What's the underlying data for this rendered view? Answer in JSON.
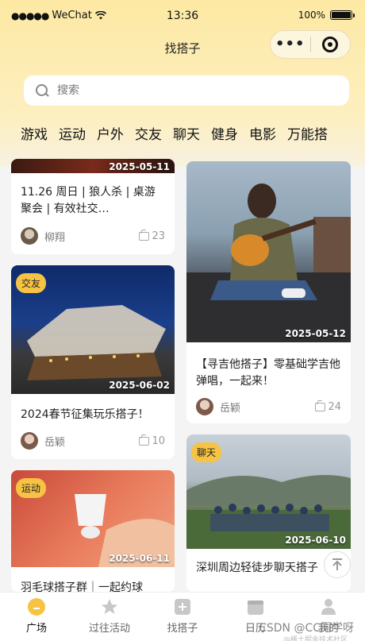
{
  "status_bar": {
    "carrier": "WeChat",
    "signal_dots": "●●●●●",
    "time": "13:36",
    "battery_text": "100%",
    "battery_level": 1.0
  },
  "nav": {
    "title": "找搭子",
    "more_glyph": "•••"
  },
  "search": {
    "placeholder": "搜索"
  },
  "categories": [
    "游戏",
    "运动",
    "户外",
    "交友",
    "聊天",
    "健身",
    "电影",
    "万能搭"
  ],
  "cards": [
    {
      "title": "11.26 周日 | 狼人杀 | 桌游聚会 | 有效社交…",
      "date": "2025-05-11",
      "tag": "",
      "user": "柳翔",
      "likes": "23"
    },
    {
      "title": "【寻吉他搭子】零基础学吉他弹唱，一起来！",
      "date": "2025-05-12",
      "tag": "",
      "user": "岳颖",
      "likes": "24"
    },
    {
      "title": "2024春节征集玩乐搭子！",
      "date": "2025-06-02",
      "tag": "交友",
      "user": "岳颖",
      "likes": "10"
    },
    {
      "title": "深圳周边轻徒步聊天搭子",
      "date": "2025-06-10",
      "tag": "聊天",
      "user": "",
      "likes": ""
    },
    {
      "title": "羽毛球搭子群｜一起约球",
      "date": "2025-06-11",
      "tag": "运动",
      "user": "",
      "likes": ""
    }
  ],
  "tabbar": [
    {
      "label": "广场",
      "icon": "home-icon",
      "active": true
    },
    {
      "label": "过往活动",
      "icon": "star-icon",
      "active": false
    },
    {
      "label": "找搭子",
      "icon": "plus-square-icon",
      "active": false
    },
    {
      "label": "日历",
      "icon": "calendar-icon",
      "active": false
    },
    {
      "label": "我的",
      "icon": "person-icon",
      "active": false
    }
  ],
  "watermark": "CSDN @CC同学呀",
  "watermark_sub": "@稀土掘金技术社区",
  "colors": {
    "accent": "#f6c344",
    "header_bg": "#fde9a3"
  }
}
